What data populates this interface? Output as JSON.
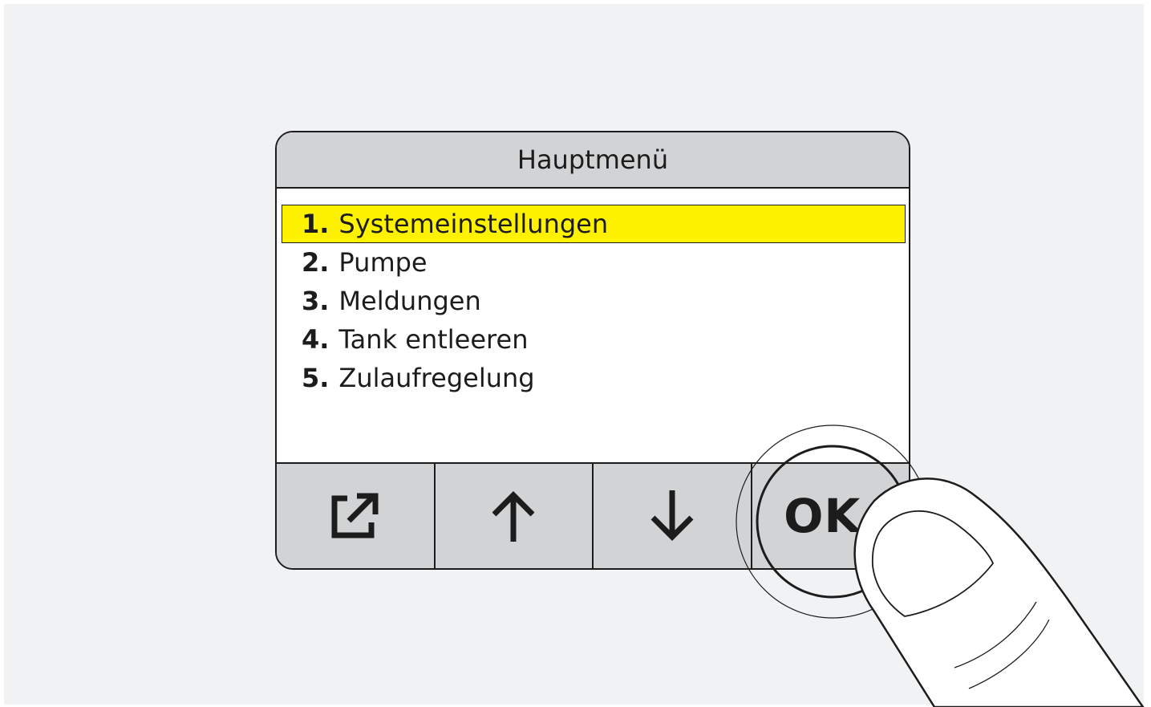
{
  "screen": {
    "title": "Hauptmenü"
  },
  "menu": {
    "items": [
      {
        "number": "1.",
        "label": "Systemeinstellungen",
        "selected": true
      },
      {
        "number": "2.",
        "label": "Pumpe",
        "selected": false
      },
      {
        "number": "3.",
        "label": "Meldungen",
        "selected": false
      },
      {
        "number": "4.",
        "label": "Tank entleeren",
        "selected": false
      },
      {
        "number": "5.",
        "label": "Zulaufregelung",
        "selected": false
      }
    ]
  },
  "softkeys": {
    "exit_icon": "exit-icon",
    "up_icon": "arrow-up-icon",
    "down_icon": "arrow-down-icon",
    "ok_label": "OK"
  },
  "colors": {
    "highlight": "#fff200",
    "panel_gray": "#d2d3d5",
    "outline": "#1c1c1c",
    "backdrop": "#f1f2f4"
  }
}
